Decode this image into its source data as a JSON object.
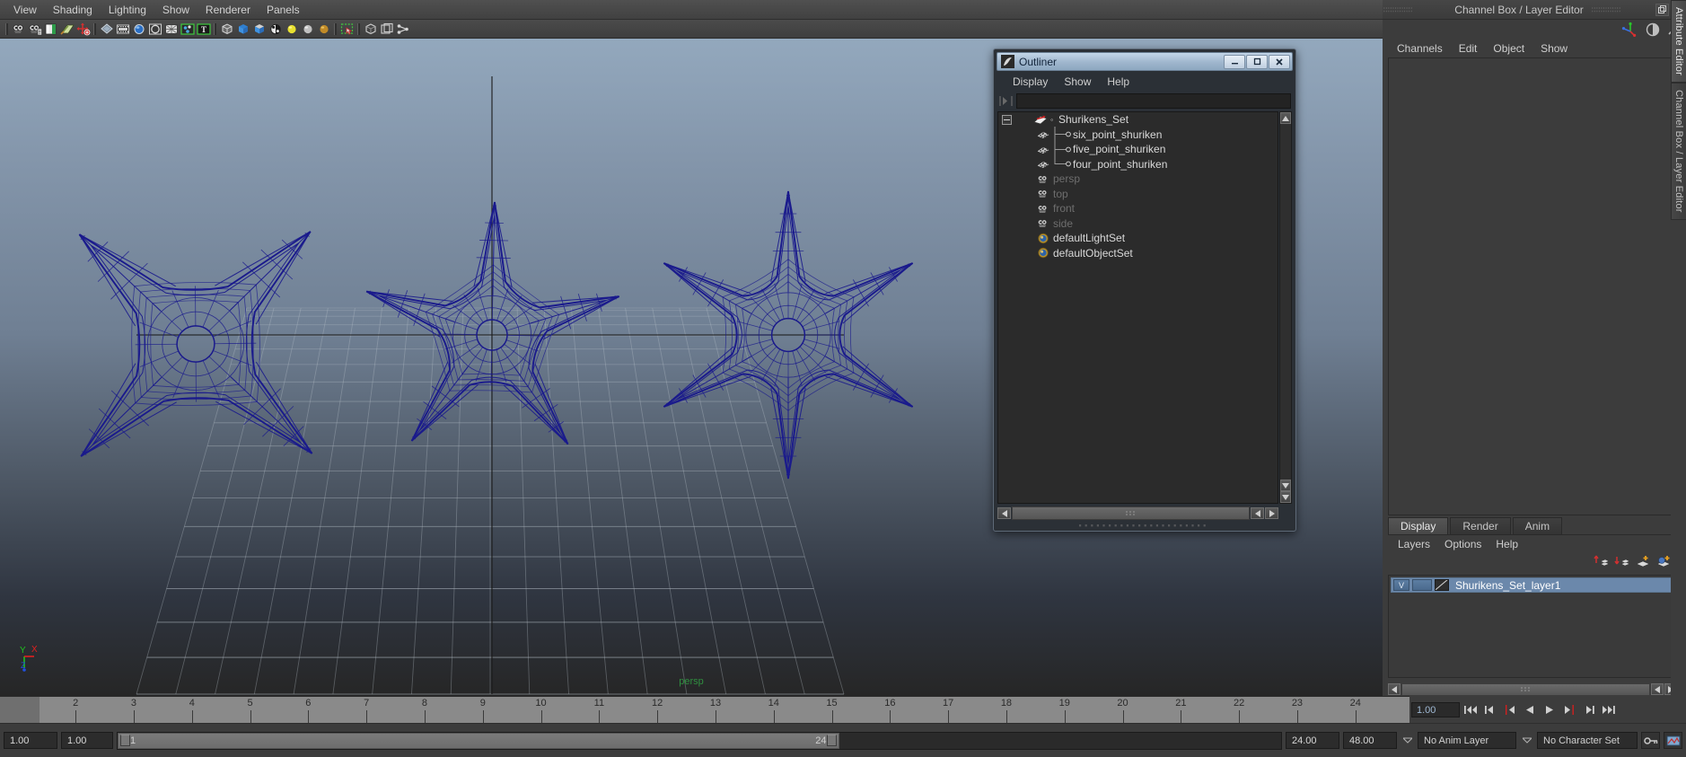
{
  "menubar": {
    "items": [
      {
        "label": "View"
      },
      {
        "label": "Shading"
      },
      {
        "label": "Lighting"
      },
      {
        "label": "Show"
      },
      {
        "label": "Renderer"
      },
      {
        "label": "Panels"
      }
    ]
  },
  "toolbar": {
    "groups": [
      {
        "icons": [
          {
            "name": "camera-icon"
          },
          {
            "name": "camera-attributes-icon"
          },
          {
            "name": "book-icon"
          },
          {
            "name": "paint-icon"
          },
          {
            "name": "move-tool-icon"
          }
        ]
      },
      {
        "icons": [
          {
            "name": "shaded-mode-icon"
          },
          {
            "name": "film-gate-icon"
          },
          {
            "name": "hardware-texture-icon"
          },
          {
            "name": "resolution-gate-icon"
          },
          {
            "name": "xray-icon"
          },
          {
            "name": "grid-display-icon"
          },
          {
            "name": "text-display-icon"
          }
        ]
      },
      {
        "icons": [
          {
            "name": "wireframe-icon"
          },
          {
            "name": "smooth-shade-icon"
          },
          {
            "name": "smooth-shade-textured-icon"
          },
          {
            "name": "texture-sphere-icon"
          },
          {
            "name": "light-yellow-icon"
          },
          {
            "name": "light-gray-icon"
          },
          {
            "name": "light-gold-icon"
          }
        ]
      },
      {
        "icons": [
          {
            "name": "selection-marquee-icon"
          }
        ]
      },
      {
        "icons": [
          {
            "name": "isolate-select-icon"
          },
          {
            "name": "bounding-box-icon"
          },
          {
            "name": "node-graph-icon"
          }
        ]
      }
    ]
  },
  "viewport": {
    "camera_label": "persp",
    "axis_labels": {
      "x": "X",
      "y": "Y",
      "z": "Z"
    },
    "colors": {
      "wireframe": "#1a1a8c",
      "camera_label": "#2f8f3f",
      "axis_x": "#e02020",
      "axis_y": "#20c020",
      "axis_z": "#2050e0",
      "sky_top": "#93a8bd",
      "sky_bottom": "#262626",
      "grid": "#b8c0c8"
    }
  },
  "outliner": {
    "title": "Outliner",
    "window_buttons": [
      {
        "name": "minimize-button",
        "glyph": "–"
      },
      {
        "name": "maximize-button",
        "glyph": "□"
      },
      {
        "name": "close-button",
        "glyph": "✕"
      }
    ],
    "menu": [
      {
        "label": "Display"
      },
      {
        "label": "Show"
      },
      {
        "label": "Help"
      }
    ],
    "search_value": "",
    "search_placeholder": "",
    "tree": [
      {
        "label": "Shurikens_Set",
        "icon": "set-icon",
        "depth": 0,
        "dim": false,
        "expander": true,
        "connector": "root"
      },
      {
        "label": "six_point_shuriken",
        "icon": "mesh-icon",
        "depth": 1,
        "dim": false,
        "expander": false,
        "connector": "tee"
      },
      {
        "label": "five_point_shuriken",
        "icon": "mesh-icon",
        "depth": 1,
        "dim": false,
        "expander": false,
        "connector": "tee"
      },
      {
        "label": "four_point_shuriken",
        "icon": "mesh-icon",
        "depth": 1,
        "dim": false,
        "expander": false,
        "connector": "elbow"
      },
      {
        "label": "persp",
        "icon": "camera-icon",
        "depth": 1,
        "dim": true,
        "expander": false,
        "connector": "none"
      },
      {
        "label": "top",
        "icon": "camera-icon",
        "depth": 1,
        "dim": true,
        "expander": false,
        "connector": "none"
      },
      {
        "label": "front",
        "icon": "camera-icon",
        "depth": 1,
        "dim": true,
        "expander": false,
        "connector": "none"
      },
      {
        "label": "side",
        "icon": "camera-icon",
        "depth": 1,
        "dim": true,
        "expander": false,
        "connector": "none"
      },
      {
        "label": "defaultLightSet",
        "icon": "set-sphere-icon",
        "depth": 1,
        "dim": false,
        "expander": false,
        "connector": "none"
      },
      {
        "label": "defaultObjectSet",
        "icon": "set-sphere-icon",
        "depth": 1,
        "dim": false,
        "expander": false,
        "connector": "none"
      }
    ]
  },
  "channel_box": {
    "title": "Channel Box / Layer Editor",
    "header_buttons": [
      {
        "name": "undock-button",
        "glyph": "◱"
      },
      {
        "name": "close-panel-button",
        "glyph": "✕"
      }
    ],
    "toolbar_icons": [
      {
        "name": "axis-gizmo-icon"
      },
      {
        "name": "half-circle-icon"
      },
      {
        "name": "arrow-up-right-icon"
      }
    ],
    "menu": [
      {
        "label": "Channels"
      },
      {
        "label": "Edit"
      },
      {
        "label": "Object"
      },
      {
        "label": "Show"
      }
    ]
  },
  "layer_editor": {
    "tabs": [
      {
        "label": "Display",
        "active": true
      },
      {
        "label": "Render",
        "active": false
      },
      {
        "label": "Anim",
        "active": false
      }
    ],
    "menu": [
      {
        "label": "Layers"
      },
      {
        "label": "Options"
      },
      {
        "label": "Help"
      }
    ],
    "buttons": [
      {
        "name": "move-layer-up-icon"
      },
      {
        "name": "move-layer-down-icon"
      },
      {
        "name": "new-layer-icon"
      },
      {
        "name": "new-layer-from-selected-icon"
      }
    ],
    "layers": [
      {
        "visibility": "V",
        "playback": "",
        "name": "Shurikens_Set_layer1",
        "selected": true
      }
    ]
  },
  "side_tabs": [
    {
      "label": "Attribute Editor",
      "active": true
    },
    {
      "label": "Channel Box / Layer Editor",
      "active": false
    }
  ],
  "timeline": {
    "ticks": [
      2,
      3,
      4,
      5,
      6,
      7,
      8,
      9,
      10,
      11,
      12,
      13,
      14,
      15,
      16,
      17,
      18,
      19,
      20,
      21,
      22,
      23,
      24
    ],
    "current_frame": "1.00"
  },
  "playback": {
    "buttons": [
      {
        "name": "go-to-start-button",
        "glyph": "start"
      },
      {
        "name": "step-back-keyframe-button",
        "glyph": "prevkey"
      },
      {
        "name": "step-back-frame-button",
        "glyph": "prevframe"
      },
      {
        "name": "play-backwards-button",
        "glyph": "playback"
      },
      {
        "name": "play-forwards-button",
        "glyph": "playfwd"
      },
      {
        "name": "step-forward-frame-button",
        "glyph": "nextframe"
      },
      {
        "name": "step-forward-keyframe-button",
        "glyph": "nextkey"
      },
      {
        "name": "go-to-end-button",
        "glyph": "end"
      }
    ]
  },
  "range_bar": {
    "anim_start": "1.00",
    "range_start_label": "1",
    "range_end_label": "24",
    "range_end": "24.00",
    "anim_end": "48.00",
    "anim_layer": "No Anim Layer",
    "character_set": "No Character Set",
    "icons": [
      {
        "name": "auto-key-icon"
      },
      {
        "name": "animation-preferences-icon"
      }
    ]
  }
}
